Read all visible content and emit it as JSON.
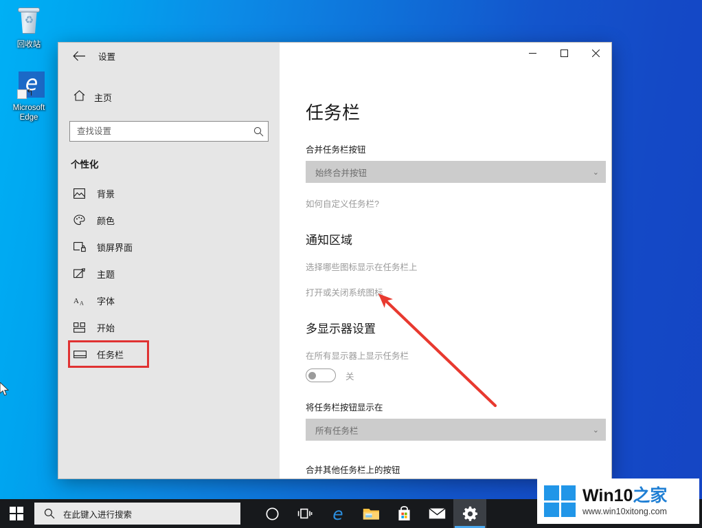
{
  "desktop": {
    "icons": [
      {
        "name": "recycle-bin",
        "label": "回收站"
      },
      {
        "name": "microsoft-edge",
        "label": "Microsoft\nEdge",
        "line1": "Microsoft",
        "line2": "Edge"
      }
    ]
  },
  "window": {
    "title": "设置",
    "back_icon": "back-arrow-icon",
    "controls": {
      "minimize": "−",
      "maximize": "□",
      "close": "✕"
    }
  },
  "sidebar": {
    "home_label": "主页",
    "home_icon": "home-icon",
    "search": {
      "placeholder": "查找设置",
      "value": "",
      "icon": "search-icon"
    },
    "heading": "个性化",
    "items": [
      {
        "label": "背景",
        "icon": "picture-icon"
      },
      {
        "label": "颜色",
        "icon": "palette-icon"
      },
      {
        "label": "锁屏界面",
        "icon": "lock-screen-icon"
      },
      {
        "label": "主题",
        "icon": "brush-icon"
      },
      {
        "label": "字体",
        "icon": "font-icon"
      },
      {
        "label": "开始",
        "icon": "start-grid-icon"
      },
      {
        "label": "任务栏",
        "icon": "taskbar-icon",
        "selected": true
      }
    ]
  },
  "content": {
    "page_title": "任务栏",
    "combine_label": "合并任务栏按钮",
    "combine_value": "始终合并按钮",
    "customize_link": "如何自定义任务栏?",
    "notification_heading": "通知区域",
    "notification_link1": "选择哪些图标显示在任务栏上",
    "notification_link2": "打开或关闭系统图标",
    "multidisplay_heading": "多显示器设置",
    "show_all_displays_label": "在所有显示器上显示任务栏",
    "toggle_state": "关",
    "taskbar_buttons_label": "将任务栏按钮显示在",
    "taskbar_buttons_value": "所有任务栏",
    "combine_other_label": "合并其他任务栏上的按钮",
    "chevron": "⌄"
  },
  "taskbar": {
    "start_icon": "windows-start-icon",
    "search_placeholder": "在此键入进行搜索",
    "search_icon": "search-icon",
    "icons": [
      {
        "name": "cortana-icon"
      },
      {
        "name": "task-view-icon"
      },
      {
        "name": "edge-icon"
      },
      {
        "name": "file-explorer-icon"
      },
      {
        "name": "microsoft-store-icon"
      },
      {
        "name": "mail-icon"
      },
      {
        "name": "settings-gear-icon",
        "active": true
      }
    ]
  },
  "watermark": {
    "line1_black": "Win10",
    "line1_blue": "之家",
    "line2": "www.win10xitong.com",
    "logo": "windows-logo-icon"
  },
  "annotation": {
    "arrow_color": "#e8392f",
    "highlight_color": "#e03232"
  }
}
